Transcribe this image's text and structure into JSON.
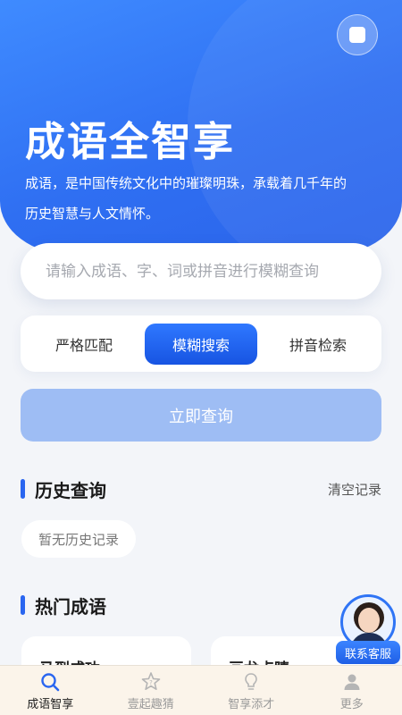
{
  "header": {
    "title": "成语全智享",
    "description": "成语，是中国传统文化中的璀璨明珠，承载着几千年的历史智慧与人文情怀。"
  },
  "search": {
    "placeholder": "请输入成语、字、词或拼音进行模糊查询",
    "value": ""
  },
  "modes": [
    {
      "label": "严格匹配",
      "selected": false
    },
    {
      "label": "模糊搜索",
      "selected": true
    },
    {
      "label": "拼音检索",
      "selected": false
    }
  ],
  "query_button": "立即查询",
  "history": {
    "title": "历史查询",
    "clear_label": "清空记录",
    "empty_text": "暂无历史记录"
  },
  "hot": {
    "title": "热门成语",
    "items": [
      "马到成功",
      "画龙点睛"
    ]
  },
  "service": {
    "label": "联系客服"
  },
  "tabs": [
    {
      "label": "成语智享",
      "icon": "search-icon",
      "active": true
    },
    {
      "label": "壹起趣猜",
      "icon": "puzzle-star-icon",
      "active": false
    },
    {
      "label": "智享添才",
      "icon": "bulb-icon",
      "active": false
    },
    {
      "label": "更多",
      "icon": "person-icon",
      "active": false
    }
  ],
  "colors": {
    "primary": "#2a66f0",
    "button_disabled": "#9ebdf4",
    "tabbar_bg": "#fbf4ea"
  }
}
